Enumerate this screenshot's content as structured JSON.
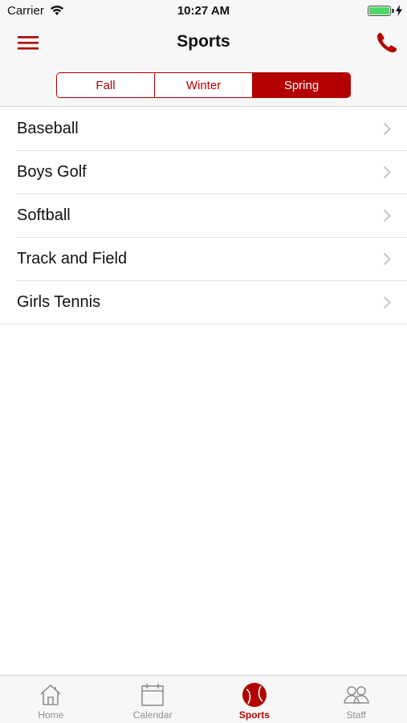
{
  "status_bar": {
    "carrier": "Carrier",
    "time": "10:27 AM",
    "battery_level": 1.0
  },
  "nav": {
    "title": "Sports",
    "left_icon": "hamburger-menu-icon",
    "right_icon": "phone-icon"
  },
  "seasons": {
    "options": [
      "Fall",
      "Winter",
      "Spring"
    ],
    "selected": "Spring"
  },
  "sports": {
    "items": [
      {
        "label": "Baseball"
      },
      {
        "label": "Boys Golf"
      },
      {
        "label": "Softball"
      },
      {
        "label": "Track and Field"
      },
      {
        "label": "Girls Tennis"
      }
    ]
  },
  "tab_bar": {
    "tabs": [
      {
        "label": "Home",
        "icon": "home-icon",
        "active": false
      },
      {
        "label": "Calendar",
        "icon": "calendar-icon",
        "active": false
      },
      {
        "label": "Sports",
        "icon": "ball-icon",
        "active": true
      },
      {
        "label": "Staff",
        "icon": "staff-icon",
        "active": false
      }
    ]
  },
  "colors": {
    "accent": "#b30000",
    "battery": "#4cd964",
    "inactive_tab": "#8e8e8e"
  }
}
